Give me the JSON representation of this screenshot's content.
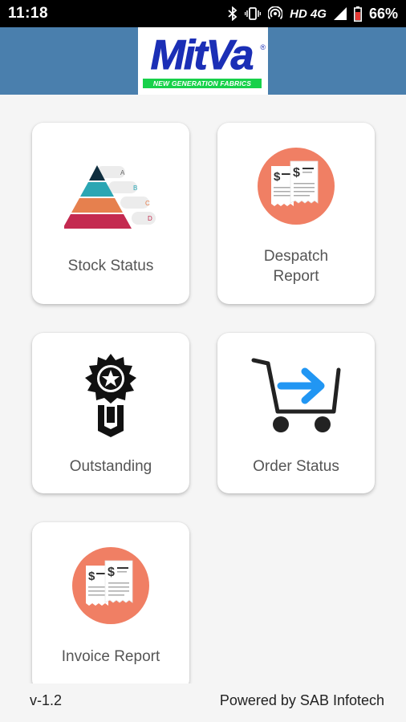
{
  "status_bar": {
    "time": "11:18",
    "network": "HD 4G",
    "battery": "66%"
  },
  "header": {
    "logo_text": "MitVa",
    "logo_tagline": "NEW GENERATION FABRICS"
  },
  "cards": {
    "stock": {
      "label": "Stock Status",
      "icon": "pyramid-chart-icon",
      "tiers": [
        "A",
        "B",
        "C",
        "D"
      ]
    },
    "despatch": {
      "label_line1": "Despatch",
      "label_line2": "Report",
      "icon": "receipt-icon"
    },
    "outstanding": {
      "label": "Outstanding",
      "icon": "award-badge-icon"
    },
    "order": {
      "label": "Order Status",
      "icon": "cart-arrow-icon"
    },
    "invoice": {
      "label": "Invoice Report",
      "icon": "receipt-icon"
    }
  },
  "footer": {
    "version": "v-1.2",
    "powered_by": "Powered by SAB Infotech"
  },
  "colors": {
    "header_bg": "#4a7fad",
    "logo_blue": "#1b2fb6",
    "logo_green": "#17d14a",
    "receipt_circle": "#f07f64",
    "arrow_blue": "#2196f3"
  }
}
